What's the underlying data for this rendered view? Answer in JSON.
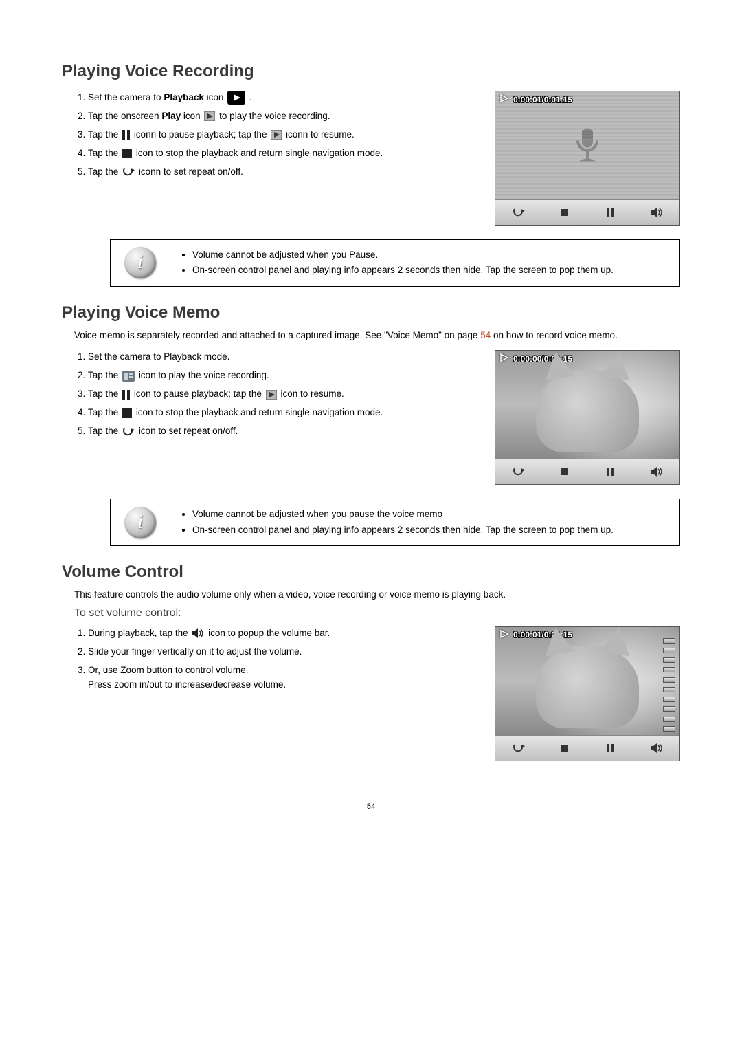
{
  "page_number": "54",
  "section1": {
    "title": "Playing Voice Recording",
    "steps": [
      {
        "a": "Set the camera to ",
        "b": "Playback",
        "c": " icon ",
        "d": "."
      },
      {
        "a": "Tap the onscreen ",
        "b": "Play",
        "c": " icon ",
        "d": " to play the voice recording."
      },
      {
        "a": "Tap the ",
        "b": " iconn to pause playback; tap the ",
        "c": " iconn to resume."
      },
      {
        "a": "Tap the ",
        "b": " icon to stop the playback and return single navigation mode."
      },
      {
        "a": "Tap the ",
        "b": " iconn to set repeat on/off."
      }
    ],
    "screen_time": "0:00:01/0:01:15",
    "note": [
      "Volume cannot be adjusted when you Pause.",
      "On-screen control panel and playing info appears 2 seconds then hide. Tap the screen to pop them up."
    ]
  },
  "section2": {
    "title": "Playing Voice Memo",
    "intro_a": "Voice memo is separately recorded and attached to a captured image. See \"Voice Memo\" on page ",
    "intro_link": "54",
    "intro_b": " on how to record voice memo.",
    "steps": [
      {
        "a": "Set the camera to Playback mode."
      },
      {
        "a": "Tap the ",
        "b": " icon to play the voice recording."
      },
      {
        "a": "Tap the ",
        "b": " icon to pause playback; tap the ",
        "c": " icon to resume."
      },
      {
        "a": "Tap the ",
        "b": " icon to stop the playback and return single navigation mode."
      },
      {
        "a": "Tap the ",
        "b": " icon to set repeat on/off."
      }
    ],
    "screen_time": "0:00:00/0:01:15",
    "note": [
      "Volume cannot be adjusted when you pause the voice memo",
      "On-screen control panel and playing info appears 2 seconds then hide. Tap the screen to pop them up."
    ]
  },
  "section3": {
    "title": "Volume Control",
    "intro": "This feature controls the audio volume only when a video, voice recording or voice memo is playing back.",
    "subhead": "To set volume control:",
    "steps": [
      {
        "a": "During playback, tap the ",
        "b": " icon to popup the volume bar."
      },
      {
        "a": "Slide your finger vertically on it to adjust the volume."
      },
      {
        "a": "Or, use Zoom button to control volume.",
        "b": "Press zoom in/out to increase/decrease volume."
      }
    ],
    "screen_time": "0:00:01/0:01:15"
  }
}
